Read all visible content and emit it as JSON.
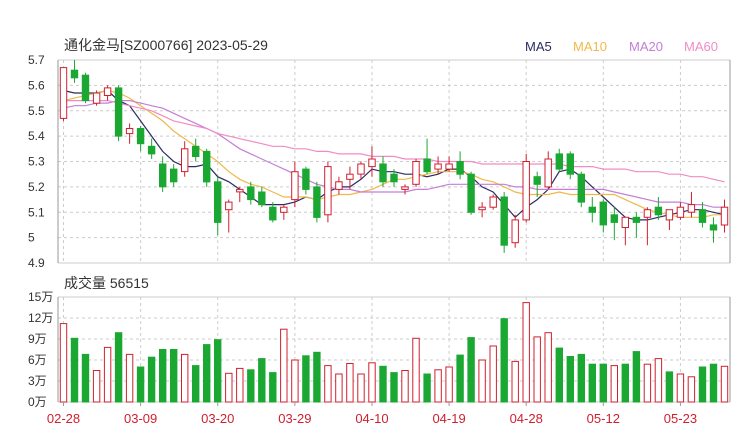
{
  "header": {
    "title": "通化金马[SZ000766] 2023-05-29"
  },
  "legend": [
    {
      "label": "MA5",
      "color": "#2b2b63"
    },
    {
      "label": "MA10",
      "color": "#f0b84a"
    },
    {
      "label": "MA20",
      "color": "#c47ed8"
    },
    {
      "label": "MA60",
      "color": "#f08cc4"
    }
  ],
  "volume_panel": {
    "title": "成交量 56515"
  },
  "colors": {
    "up": "#d02030",
    "down": "#1aa832",
    "grid": "#cccccc"
  },
  "chart_data": [
    {
      "type": "candlestick",
      "title": "通化金马[SZ000766] 2023-05-29",
      "ylim": [
        4.9,
        5.7
      ],
      "y_ticks": [
        "5.7",
        "5.6",
        "5.5",
        "5.4",
        "5.3",
        "5.2",
        "5.1",
        "5",
        "4.9"
      ],
      "x_tick_labels": [
        {
          "index": 0,
          "label": "02-28"
        },
        {
          "index": 7,
          "label": "03-09"
        },
        {
          "index": 14,
          "label": "03-20"
        },
        {
          "index": 21,
          "label": "03-29"
        },
        {
          "index": 28,
          "label": "04-10"
        },
        {
          "index": 35,
          "label": "04-19"
        },
        {
          "index": 42,
          "label": "04-28"
        },
        {
          "index": 49,
          "label": "05-12"
        },
        {
          "index": 56,
          "label": "05-23"
        }
      ],
      "ohlc": [
        [
          5.47,
          5.67,
          5.46,
          5.67
        ],
        [
          5.66,
          5.7,
          5.61,
          5.63
        ],
        [
          5.64,
          5.65,
          5.53,
          5.54
        ],
        [
          5.53,
          5.58,
          5.52,
          5.57
        ],
        [
          5.56,
          5.6,
          5.54,
          5.59
        ],
        [
          5.59,
          5.6,
          5.38,
          5.4
        ],
        [
          5.41,
          5.45,
          5.37,
          5.43
        ],
        [
          5.43,
          5.44,
          5.34,
          5.37
        ],
        [
          5.36,
          5.39,
          5.31,
          5.33
        ],
        [
          5.29,
          5.32,
          5.18,
          5.2
        ],
        [
          5.27,
          5.29,
          5.2,
          5.22
        ],
        [
          5.26,
          5.38,
          5.24,
          5.35
        ],
        [
          5.36,
          5.39,
          5.3,
          5.32
        ],
        [
          5.34,
          5.35,
          5.2,
          5.22
        ],
        [
          5.22,
          5.24,
          5.01,
          5.06
        ],
        [
          5.11,
          5.15,
          5.02,
          5.14
        ],
        [
          5.18,
          5.2,
          5.14,
          5.19
        ],
        [
          5.2,
          5.22,
          5.13,
          5.15
        ],
        [
          5.18,
          5.2,
          5.12,
          5.13
        ],
        [
          5.12,
          5.14,
          5.06,
          5.07
        ],
        [
          5.1,
          5.13,
          5.07,
          5.12
        ],
        [
          5.15,
          5.3,
          5.12,
          5.26
        ],
        [
          5.27,
          5.28,
          5.17,
          5.19
        ],
        [
          5.2,
          5.22,
          5.06,
          5.08
        ],
        [
          5.09,
          5.3,
          5.06,
          5.28
        ],
        [
          5.19,
          5.24,
          5.17,
          5.22
        ],
        [
          5.23,
          5.28,
          5.19,
          5.25
        ],
        [
          5.25,
          5.3,
          5.23,
          5.29
        ],
        [
          5.28,
          5.36,
          5.24,
          5.31
        ],
        [
          5.29,
          5.32,
          5.2,
          5.22
        ],
        [
          5.25,
          5.27,
          5.2,
          5.22
        ],
        [
          5.19,
          5.21,
          5.17,
          5.2
        ],
        [
          5.21,
          5.31,
          5.2,
          5.3
        ],
        [
          5.31,
          5.39,
          5.25,
          5.26
        ],
        [
          5.27,
          5.32,
          5.25,
          5.29
        ],
        [
          5.27,
          5.32,
          5.26,
          5.29
        ],
        [
          5.3,
          5.34,
          5.23,
          5.25
        ],
        [
          5.25,
          5.26,
          5.09,
          5.1
        ],
        [
          5.11,
          5.14,
          5.08,
          5.12
        ],
        [
          5.12,
          5.17,
          5.11,
          5.16
        ],
        [
          5.16,
          5.18,
          4.94,
          4.97
        ],
        [
          4.98,
          5.09,
          4.96,
          5.07
        ],
        [
          5.07,
          5.33,
          5.06,
          5.3
        ],
        [
          5.24,
          5.26,
          5.16,
          5.21
        ],
        [
          5.2,
          5.34,
          5.19,
          5.31
        ],
        [
          5.33,
          5.35,
          5.26,
          5.27
        ],
        [
          5.33,
          5.34,
          5.23,
          5.25
        ],
        [
          5.25,
          5.26,
          5.12,
          5.14
        ],
        [
          5.12,
          5.16,
          5.06,
          5.1
        ],
        [
          5.14,
          5.15,
          5.02,
          5.05
        ],
        [
          5.09,
          5.12,
          4.99,
          5.06
        ],
        [
          5.04,
          5.08,
          4.97,
          5.08
        ],
        [
          5.08,
          5.1,
          5.0,
          5.06
        ],
        [
          5.08,
          5.12,
          4.97,
          5.11
        ],
        [
          5.12,
          5.16,
          5.07,
          5.09
        ],
        [
          5.07,
          5.1,
          5.03,
          5.11
        ],
        [
          5.08,
          5.14,
          5.07,
          5.12
        ],
        [
          5.1,
          5.18,
          5.08,
          5.13
        ],
        [
          5.11,
          5.14,
          5.04,
          5.06
        ],
        [
          5.05,
          5.08,
          4.98,
          5.03
        ],
        [
          5.05,
          5.15,
          5.02,
          5.12
        ]
      ],
      "ma": {
        "MA5": [
          5.58,
          5.57,
          5.57,
          5.57,
          5.58,
          5.54,
          5.52,
          5.46,
          5.4,
          5.34,
          5.3,
          5.28,
          5.28,
          5.29,
          5.24,
          5.22,
          5.19,
          5.16,
          5.13,
          5.13,
          5.13,
          5.14,
          5.16,
          5.15,
          5.18,
          5.2,
          5.2,
          5.23,
          5.27,
          5.26,
          5.26,
          5.25,
          5.25,
          5.24,
          5.25,
          5.27,
          5.27,
          5.24,
          5.2,
          5.18,
          5.13,
          5.08,
          5.12,
          5.15,
          5.19,
          5.26,
          5.27,
          5.24,
          5.2,
          5.16,
          5.12,
          5.08,
          5.07,
          5.07,
          5.08,
          5.09,
          5.1,
          5.11,
          5.11,
          5.1,
          5.09
        ],
        "MA10": [
          5.54,
          5.55,
          5.56,
          5.57,
          5.58,
          5.57,
          5.55,
          5.52,
          5.49,
          5.46,
          5.42,
          5.39,
          5.36,
          5.33,
          5.3,
          5.26,
          5.23,
          5.21,
          5.2,
          5.18,
          5.16,
          5.16,
          5.16,
          5.15,
          5.16,
          5.17,
          5.17,
          5.18,
          5.19,
          5.21,
          5.23,
          5.23,
          5.24,
          5.25,
          5.26,
          5.26,
          5.26,
          5.25,
          5.23,
          5.22,
          5.2,
          5.18,
          5.17,
          5.17,
          5.17,
          5.18,
          5.17,
          5.17,
          5.17,
          5.17,
          5.17,
          5.15,
          5.13,
          5.11,
          5.1,
          5.09,
          5.08,
          5.08,
          5.08,
          5.09,
          5.09
        ],
        "MA20": [
          5.51,
          5.52,
          5.52,
          5.53,
          5.53,
          5.54,
          5.54,
          5.53,
          5.52,
          5.51,
          5.49,
          5.47,
          5.45,
          5.43,
          5.41,
          5.38,
          5.35,
          5.33,
          5.31,
          5.29,
          5.27,
          5.25,
          5.23,
          5.21,
          5.2,
          5.19,
          5.19,
          5.18,
          5.18,
          5.18,
          5.18,
          5.18,
          5.19,
          5.19,
          5.2,
          5.21,
          5.21,
          5.21,
          5.21,
          5.21,
          5.21,
          5.2,
          5.2,
          5.19,
          5.19,
          5.19,
          5.19,
          5.19,
          5.19,
          5.19,
          5.18,
          5.17,
          5.16,
          5.15,
          5.14,
          5.14,
          5.14,
          5.13,
          5.13,
          5.12,
          5.12
        ],
        "MA60": [
          5.54,
          5.54,
          5.54,
          5.54,
          5.54,
          5.53,
          5.52,
          5.51,
          5.5,
          5.48,
          5.46,
          5.45,
          5.44,
          5.43,
          5.41,
          5.4,
          5.39,
          5.38,
          5.37,
          5.36,
          5.36,
          5.35,
          5.35,
          5.34,
          5.34,
          5.33,
          5.33,
          5.33,
          5.32,
          5.32,
          5.32,
          5.31,
          5.31,
          5.31,
          5.3,
          5.3,
          5.3,
          5.3,
          5.29,
          5.29,
          5.29,
          5.29,
          5.29,
          5.29,
          5.29,
          5.29,
          5.28,
          5.28,
          5.28,
          5.27,
          5.27,
          5.27,
          5.26,
          5.26,
          5.26,
          5.25,
          5.25,
          5.24,
          5.24,
          5.23,
          5.22
        ]
      },
      "legend": [
        "MA5",
        "MA10",
        "MA20",
        "MA60"
      ],
      "grid": true
    },
    {
      "type": "bar",
      "title": "成交量 56515",
      "ylim": [
        0,
        150000
      ],
      "y_ticks": [
        "15万",
        "12万",
        "9万",
        "6万",
        "3万",
        "0万"
      ],
      "values": [
        112000,
        91000,
        68000,
        45000,
        78000,
        99000,
        68000,
        50000,
        64000,
        75000,
        75000,
        68000,
        52000,
        82000,
        89000,
        41000,
        48000,
        46000,
        62000,
        42000,
        104000,
        60000,
        66000,
        71000,
        52000,
        40000,
        55000,
        40000,
        56000,
        51000,
        42000,
        45000,
        91000,
        40000,
        46000,
        50000,
        67000,
        92000,
        60000,
        80000,
        119000,
        58000,
        142000,
        93000,
        99000,
        77000,
        65000,
        68000,
        54000,
        54000,
        52000,
        54000,
        72000,
        54000,
        62000,
        43000,
        40000,
        36000,
        50000,
        54000,
        51000
      ],
      "up_down": [
        "u",
        "d",
        "d",
        "u",
        "u",
        "d",
        "u",
        "d",
        "d",
        "d",
        "d",
        "u",
        "d",
        "d",
        "d",
        "u",
        "u",
        "d",
        "d",
        "d",
        "u",
        "u",
        "d",
        "d",
        "u",
        "u",
        "u",
        "u",
        "u",
        "d",
        "d",
        "u",
        "u",
        "d",
        "u",
        "u",
        "d",
        "d",
        "u",
        "u",
        "d",
        "u",
        "u",
        "u",
        "u",
        "d",
        "d",
        "d",
        "d",
        "d",
        "u",
        "d",
        "d",
        "u",
        "u",
        "d",
        "u",
        "u",
        "d",
        "d",
        "u"
      ]
    }
  ]
}
